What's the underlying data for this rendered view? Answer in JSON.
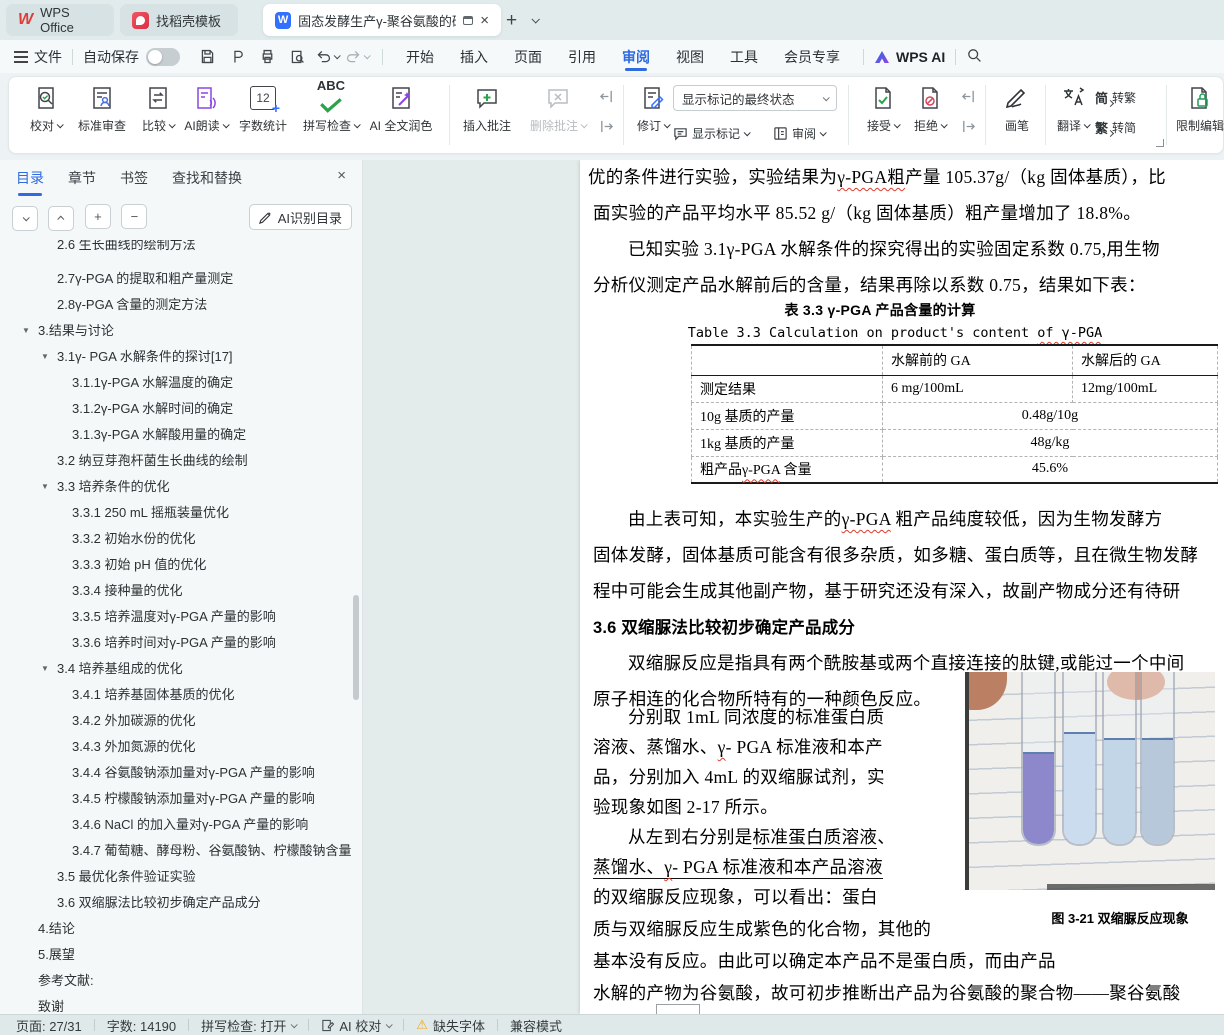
{
  "colors": {
    "accent": "#2f6ae0",
    "wps_red": "#e23c39",
    "doc_blue": "#3370ff",
    "squiggle": "#e0392b",
    "green": "#2ba24c",
    "red": "#d9455c",
    "purple": "#8a46e4"
  },
  "glyphs": {
    "close": "×",
    "plus": "+",
    "minus": "−",
    "triangle_down": "▼",
    "warning": "⚠"
  },
  "tabbar": {
    "wps_tab": "WPS Office",
    "template_tab": "找稻壳模板",
    "doc_tab": "固态发酵生产γ-聚谷氨酸的研"
  },
  "menubar": {
    "file_menu": "文件",
    "autosave_label": "自动保存",
    "tabs": [
      "开始",
      "插入",
      "页面",
      "引用",
      "审阅",
      "视图",
      "工具",
      "会员专享"
    ],
    "wps_ai_label": "WPS AI"
  },
  "ribbon": {
    "proofread": "校对",
    "standard_review": "标准审查",
    "compare": "比较",
    "ai_read_aloud": "AI朗读",
    "word_count": "字数统计",
    "spell_check": "拼写检查",
    "ai_polish": "AI 全文润色",
    "insert_comment": "插入批注",
    "delete_comment": "删除批注",
    "track_changes": "修订",
    "markup_state": "显示标记的最终状态",
    "show_markup": "显示标记",
    "review_pane": "审阅",
    "accept": "接受",
    "reject": "拒绝",
    "draw": "画笔",
    "translate": "翻译",
    "s2t_prefix": "简",
    "s2t_label": "转繁",
    "t2s_prefix": "繁",
    "t2s_label": "转简",
    "restrict_edit": "限制编辑",
    "word_count_icon_text": "12",
    "spell_icon_text": "ABC"
  },
  "sidebar": {
    "tabs": [
      "目录",
      "章节",
      "书签",
      "查找和替换"
    ],
    "ai_toc_button": "AI识别目录",
    "toc": [
      {
        "t": "2.6 生长曲线的绘制方法",
        "cls": "lv2 cut",
        "arrow": ""
      },
      {
        "t": "2.7γ-PGA 的提取和粗产量测定",
        "cls": "lv2",
        "arrow": ""
      },
      {
        "t": "2.8γ-PGA 含量的测定方法",
        "cls": "lv2",
        "arrow": ""
      },
      {
        "t": "3.结果与讨论",
        "cls": "lv1",
        "arrow": "▼"
      },
      {
        "t": "3.1γ- PGA 水解条件的探讨[17]",
        "cls": "lv2",
        "arrow": "▼"
      },
      {
        "t": "3.1.1γ-PGA 水解温度的确定",
        "cls": "lv3",
        "arrow": ""
      },
      {
        "t": "3.1.2γ-PGA 水解时间的确定",
        "cls": "lv3",
        "arrow": ""
      },
      {
        "t": "3.1.3γ-PGA 水解酸用量的确定",
        "cls": "lv3",
        "arrow": ""
      },
      {
        "t": "3.2 纳豆芽孢杆菌生长曲线的绘制",
        "cls": "lv2",
        "arrow": ""
      },
      {
        "t": "3.3 培养条件的优化",
        "cls": "lv2",
        "arrow": "▼"
      },
      {
        "t": "3.3.1 250 mL 摇瓶装量优化",
        "cls": "lv3",
        "arrow": ""
      },
      {
        "t": "3.3.2 初始水份的优化",
        "cls": "lv3",
        "arrow": ""
      },
      {
        "t": "3.3.3 初始 pH 值的优化",
        "cls": "lv3",
        "arrow": ""
      },
      {
        "t": "3.3.4 接种量的优化",
        "cls": "lv3",
        "arrow": ""
      },
      {
        "t": "3.3.5 培养温度对γ-PGA 产量的影响",
        "cls": "lv3",
        "arrow": ""
      },
      {
        "t": "3.3.6 培养时间对γ-PGA 产量的影响",
        "cls": "lv3",
        "arrow": ""
      },
      {
        "t": "3.4 培养基组成的优化",
        "cls": "lv2",
        "arrow": "▼"
      },
      {
        "t": "3.4.1 培养基固体基质的优化",
        "cls": "lv3",
        "arrow": ""
      },
      {
        "t": "3.4.2 外加碳源的优化",
        "cls": "lv3",
        "arrow": ""
      },
      {
        "t": "3.4.3 外加氮源的优化",
        "cls": "lv3",
        "arrow": ""
      },
      {
        "t": "3.4.4 谷氨酸钠添加量对γ-PGA 产量的影响",
        "cls": "lv3",
        "arrow": ""
      },
      {
        "t": "3.4.5 柠檬酸钠添加量对γ-PGA 产量的影响",
        "cls": "lv3",
        "arrow": ""
      },
      {
        "t": "3.4.6 NaCl 的加入量对γ-PGA 产量的影响",
        "cls": "lv3",
        "arrow": ""
      },
      {
        "t": "3.4.7 葡萄糖、酵母粉、谷氨酸钠、柠檬酸钠含量 ...",
        "cls": "lv3",
        "arrow": ""
      },
      {
        "t": "3.5 最优化条件验证实验",
        "cls": "lv2",
        "arrow": ""
      },
      {
        "t": "3.6 双缩脲法比较初步确定产品成分",
        "cls": "lv2",
        "arrow": ""
      },
      {
        "t": "4.结论",
        "cls": "lv1",
        "arrow": ""
      },
      {
        "t": "5.展望",
        "cls": "lv1",
        "arrow": ""
      },
      {
        "t": "参考文献:",
        "cls": "lv1",
        "arrow": ""
      },
      {
        "t": "致谢",
        "cls": "lv1",
        "arrow": ""
      }
    ]
  },
  "doc": {
    "l1a": "优的条件进行实验，实验结果为",
    "l1b": "γ-PGA粗",
    "l1c": "产量 105.37g/（kg 固体基质），比",
    "l2": "面实验的产品平均水平 85.52 g/（kg 固体基质）粗产量增加了 18.8%。",
    "l3": "已知实验 3.1γ-PGA 水解条件的探究得出的实验固定系数 0.75,用生物",
    "l4": "分析仪测定产品水解前后的含量，结果再除以系数 0.75，结果如下表：",
    "cap_cn": "表 3.3 γ-PGA 产品含量的计算",
    "cap_en_a": "Table 3.3 Calculation on product's content ",
    "cap_en_b": "of γ-PGA",
    "table": {
      "col_before": "水解前的 GA",
      "col_after": "水解后的 GA",
      "r1_label": "测定结果",
      "r1_before": "6 mg/100mL",
      "r1_after": "12mg/100mL",
      "r2_label": "10g 基质的产量",
      "r2_value": "0.48g/10g",
      "r3_label": "1kg 基质的产量",
      "r3_value": "48g/kg",
      "r4_label_a": "粗产品",
      "r4_label_b": "γ-PGA",
      "r4_label_c": " 含量",
      "r4_value": "45.6%"
    },
    "p2a": "由上表可知，本实验生产的",
    "p2b": "γ-PGA",
    "p2c": " 粗产品纯度较低，因为生物发酵方",
    "p2l2": "固体发酵，固体基质可能含有很多杂质，如多糖、蛋白质等，且在微生物发酵",
    "p2l3": "程中可能会生成其他副产物，基于研究还没有深入，故副产物成分还有待研",
    "h36": "3.6 双缩脲法比较初步确定产品成分",
    "p3l1": "双缩脲反应是指具有两个酰胺基或两个直接连接的肽键,或能过一个中间",
    "p3l2": "原子相连的化合物所特有的一种颜色反应。",
    "c1": "分别取 1mL 同浓度的标准蛋白质",
    "c2a": "溶液、蒸馏水、",
    "c2b": "γ",
    "c2c": "- PGA 标准液和本产",
    "c3": "品，分别加入 4mL 的双缩脲试剂，实",
    "c4": "验现象如图 2-17 所示。",
    "c5a": "从左到右分别是",
    "c5b": "标准蛋白质溶液",
    "c5c": "、",
    "c6a": "蒸馏水、",
    "c6b": "γ",
    "c6c": "- PGA 标准液",
    "c6d": "和",
    "c6e": "本产品溶液",
    "c7": "的双缩脲反应现象，可以看出：蛋白",
    "p4l1": "质与双缩脲反应生成紫色的化合物，其他的",
    "p4l2": "基本没有反应。由此可以确定本产品不是蛋白质，而由产品",
    "p4l3": "水解的产物为谷氨酸，故可初步推断出产品为谷氨酸的聚合物——聚谷氨酸",
    "fig_caption": "图 3-21 双缩脲反应现象"
  },
  "statusbar": {
    "page_info": "页面: 27/31",
    "word_count": "字数: 14190",
    "spell_check": "拼写检查: 打开",
    "ai_proofread": "AI 校对",
    "missing_font": "缺失字体",
    "compat_mode": "兼容模式"
  }
}
